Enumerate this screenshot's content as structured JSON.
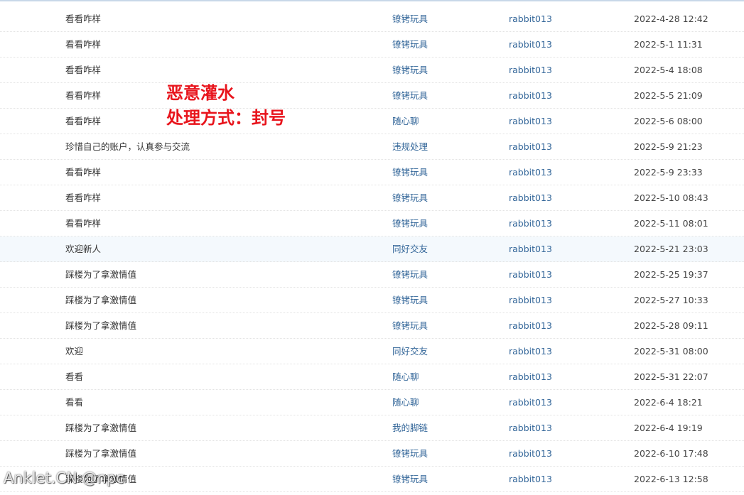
{
  "posts": [
    {
      "title": "看看咋样",
      "forum": "镣铐玩具",
      "author": "rabbit013",
      "time": "2022-4-28 12:42"
    },
    {
      "title": "看看咋样",
      "forum": "镣铐玩具",
      "author": "rabbit013",
      "time": "2022-5-1 11:31"
    },
    {
      "title": "看看咋样",
      "forum": "镣铐玩具",
      "author": "rabbit013",
      "time": "2022-5-4 18:08"
    },
    {
      "title": "看看咋样",
      "forum": "镣铐玩具",
      "author": "rabbit013",
      "time": "2022-5-5 21:09"
    },
    {
      "title": "看看咋样",
      "forum": "随心聊",
      "author": "rabbit013",
      "time": "2022-5-6 08:00"
    },
    {
      "title": "珍惜自己的账户，认真参与交流",
      "forum": "违规处理",
      "author": "rabbit013",
      "time": "2022-5-9 21:23"
    },
    {
      "title": "看看咋样",
      "forum": "镣铐玩具",
      "author": "rabbit013",
      "time": "2022-5-9 23:33"
    },
    {
      "title": "看看咋样",
      "forum": "镣铐玩具",
      "author": "rabbit013",
      "time": "2022-5-10 08:43"
    },
    {
      "title": "看看咋样",
      "forum": "镣铐玩具",
      "author": "rabbit013",
      "time": "2022-5-11 08:01"
    },
    {
      "title": "欢迎新人",
      "forum": "同好交友",
      "author": "rabbit013",
      "time": "2022-5-21 23:03"
    },
    {
      "title": "踩楼为了拿激情值",
      "forum": "镣铐玩具",
      "author": "rabbit013",
      "time": "2022-5-25 19:37"
    },
    {
      "title": "踩楼为了拿激情值",
      "forum": "镣铐玩具",
      "author": "rabbit013",
      "time": "2022-5-27 10:33"
    },
    {
      "title": "踩楼为了拿激情值",
      "forum": "镣铐玩具",
      "author": "rabbit013",
      "time": "2022-5-28 09:11"
    },
    {
      "title": "欢迎",
      "forum": "同好交友",
      "author": "rabbit013",
      "time": "2022-5-31 08:00"
    },
    {
      "title": "看看",
      "forum": "随心聊",
      "author": "rabbit013",
      "time": "2022-5-31 22:07"
    },
    {
      "title": "看看",
      "forum": "随心聊",
      "author": "rabbit013",
      "time": "2022-6-4 18:21"
    },
    {
      "title": "踩楼为了拿激情值",
      "forum": "我的脚链",
      "author": "rabbit013",
      "time": "2022-6-4 19:19"
    },
    {
      "title": "踩楼为了拿激情值",
      "forum": "镣铐玩具",
      "author": "rabbit013",
      "time": "2022-6-10 17:48"
    },
    {
      "title": "踩楼为了拿激情值",
      "forum": "镣铐玩具",
      "author": "rabbit013",
      "time": "2022-6-13 12:58"
    }
  ],
  "annotation": {
    "line1": "恶意灌水",
    "line2": "处理方式：封号"
  },
  "watermark": "Anklet.CN @npc",
  "colors": {
    "link": "#336699",
    "annotation": "#e8141c",
    "row_highlight": "#f4f9fd"
  }
}
